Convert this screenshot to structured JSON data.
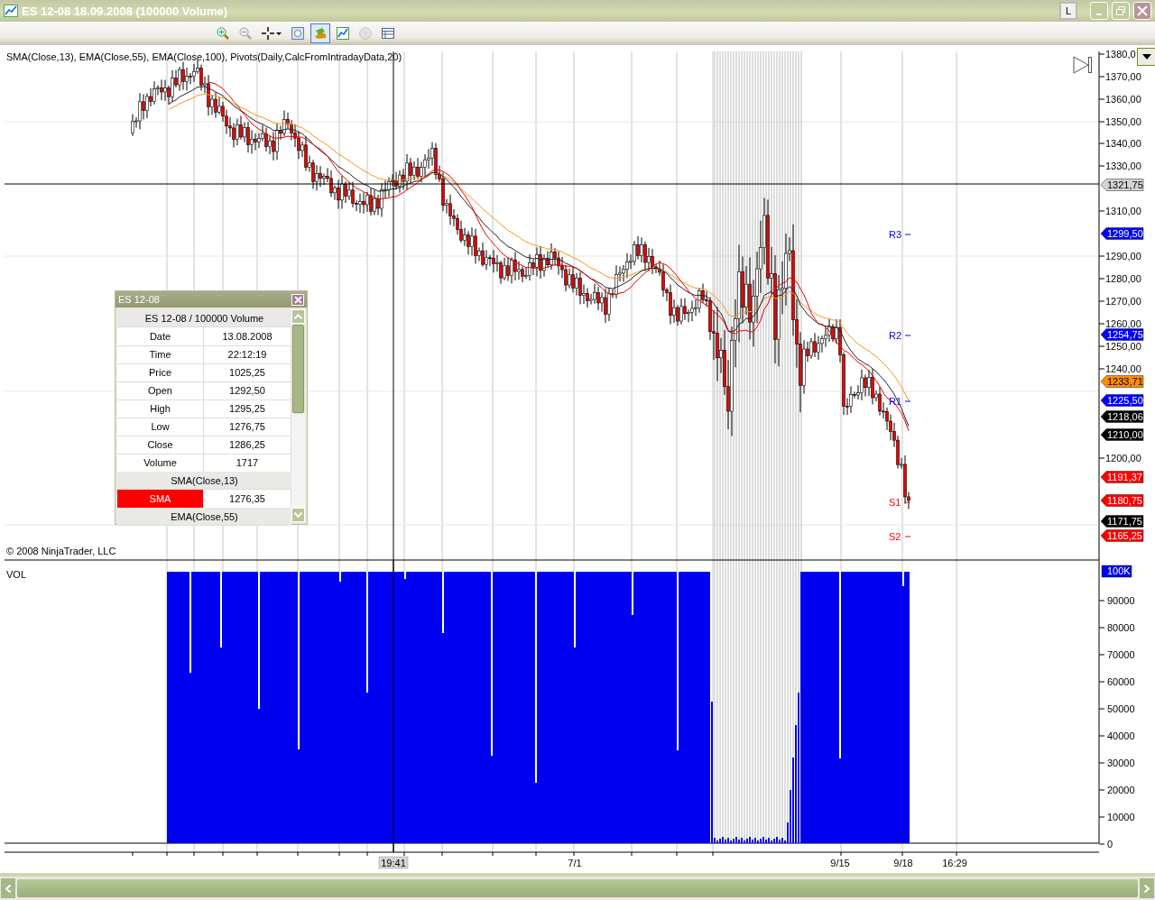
{
  "window": {
    "title": "ES 12-08  18.09.2008 (100000 Volume)",
    "button_label": "L"
  },
  "toolbar": {
    "buttons": [
      {
        "selected": false,
        "disabled": false
      },
      {
        "selected": false,
        "disabled": false
      },
      {
        "selected": false,
        "disabled": false
      },
      {
        "selected": false,
        "disabled": false
      },
      {
        "selected": true,
        "disabled": false
      },
      {
        "selected": false,
        "disabled": false
      },
      {
        "selected": false,
        "disabled": true
      },
      {
        "selected": false,
        "disabled": false
      }
    ]
  },
  "indicator_label": "SMA(Close,13), EMA(Close,55), EMA(Close,100), Pivots(Daily,CalcFromIntradayData,20)",
  "copyright": "© 2008 NinjaTrader, LLC",
  "price_axis": {
    "ticks": [
      "1380,0",
      "1370,00",
      "1360,00",
      "1350,00",
      "1340,00",
      "1330,00",
      "1310,00",
      "1290,00",
      "1280,00",
      "1270,00",
      "1260,00",
      "1250,00",
      "1240,00",
      "1200,00"
    ]
  },
  "price_markers": [
    {
      "text": "1321,75",
      "color": "#d4d4d4"
    },
    {
      "text": "1299,50",
      "color": "#0000ff"
    },
    {
      "text": "1254,75",
      "color": "#0000ff"
    },
    {
      "text": "1233,71",
      "color": "#ff8c00"
    },
    {
      "text": "1225,50",
      "color": "#0000ff"
    },
    {
      "text": "1218,06",
      "color": "#000000"
    },
    {
      "text": "1210,00",
      "color": "#000000"
    },
    {
      "text": "1191,37",
      "color": "#ff0000"
    },
    {
      "text": "1180,75",
      "color": "#ff0000"
    },
    {
      "text": "1171,75",
      "color": "#000000"
    },
    {
      "text": "1165,25",
      "color": "#ff0000"
    }
  ],
  "pivot_labels": [
    {
      "text": "R3",
      "color": "#0000ff"
    },
    {
      "text": "R2",
      "color": "#0000ff"
    },
    {
      "text": "R1",
      "color": "#0000ff"
    },
    {
      "text": "S1",
      "color": "#ff0000"
    },
    {
      "text": "S2",
      "color": "#ff0000"
    }
  ],
  "volume_pane": {
    "title": "VOL",
    "max_marker": "100K",
    "ticks": [
      "90000",
      "80000",
      "70000",
      "60000",
      "50000",
      "40000",
      "30000",
      "20000",
      "10000",
      "0"
    ]
  },
  "time_axis": {
    "labels": [
      {
        "text": "19:41",
        "kind": "crosshair"
      },
      {
        "text": "7/1",
        "kind": "date"
      },
      {
        "text": "9/15",
        "kind": "date"
      },
      {
        "text": "9/18",
        "kind": "date"
      },
      {
        "text": "16:29",
        "kind": "date"
      }
    ]
  },
  "data_box": {
    "title": "ES 12-08",
    "header": "ES 12-08 / 100000 Volume",
    "rows": [
      {
        "kind": "row",
        "label": "Date",
        "value": "13.08.2008"
      },
      {
        "kind": "row",
        "label": "Time",
        "value": "22:12:19"
      },
      {
        "kind": "row",
        "label": "Price",
        "value": "1025,25"
      },
      {
        "kind": "row",
        "label": "Open",
        "value": "1292,50"
      },
      {
        "kind": "row",
        "label": "High",
        "value": "1295,25"
      },
      {
        "kind": "row",
        "label": "Low",
        "value": "1276,75"
      },
      {
        "kind": "row",
        "label": "Close",
        "value": "1286,25"
      },
      {
        "kind": "row",
        "label": "Volume",
        "value": "1717"
      },
      {
        "kind": "section",
        "label": "SMA(Close,13)"
      },
      {
        "kind": "plot",
        "label": "SMA",
        "value": "1276,35",
        "color": "#ff0000"
      },
      {
        "kind": "section",
        "label": "EMA(Close,55)"
      }
    ]
  }
}
